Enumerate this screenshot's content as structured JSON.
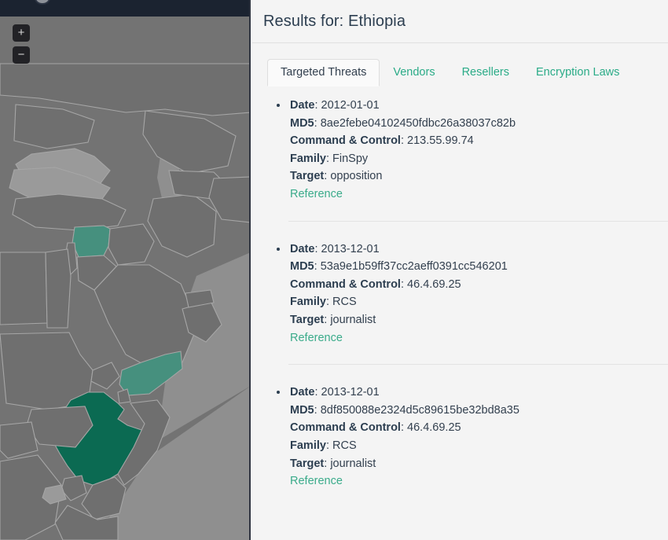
{
  "map": {
    "zoom_in_label": "+",
    "zoom_out_label": "−",
    "colors": {
      "background": "#737373",
      "land": "#6f6f6f",
      "border": "#a6a6a6",
      "highlight_selected": "#0b6a52",
      "highlight_other": "#46907e",
      "topbar": "#1b2330"
    },
    "selected_country": "Ethiopia",
    "highlighted_countries": [
      "Ethiopia",
      "Yemen",
      "Syria"
    ]
  },
  "header": {
    "title": "Results for: Ethiopia"
  },
  "tabs": [
    {
      "label": "Targeted Threats",
      "active": true
    },
    {
      "label": "Vendors",
      "active": false
    },
    {
      "label": "Resellers",
      "active": false
    },
    {
      "label": "Encryption Laws",
      "active": false
    }
  ],
  "labels": {
    "date": "Date",
    "md5": "MD5",
    "cc": "Command & Control",
    "family": "Family",
    "target": "Target",
    "reference": "Reference"
  },
  "results": [
    {
      "date": "2012-01-01",
      "md5": "8ae2febe04102450fdbc26a38037c82b",
      "cc": "213.55.99.74",
      "family": "FinSpy",
      "target": "opposition",
      "reference": "Reference"
    },
    {
      "date": "2013-12-01",
      "md5": "53a9e1b59ff37cc2aeff0391cc546201",
      "cc": "46.4.69.25",
      "family": "RCS",
      "target": "journalist",
      "reference": "Reference"
    },
    {
      "date": "2013-12-01",
      "md5": "8df850088e2324d5c89615be32bd8a35",
      "cc": "46.4.69.25",
      "family": "RCS",
      "target": "journalist",
      "reference": "Reference"
    }
  ],
  "colors": {
    "accent": "#2aab87",
    "link": "#3aab8a",
    "text": "#33404f",
    "panel_bg": "#f4f4f4"
  }
}
